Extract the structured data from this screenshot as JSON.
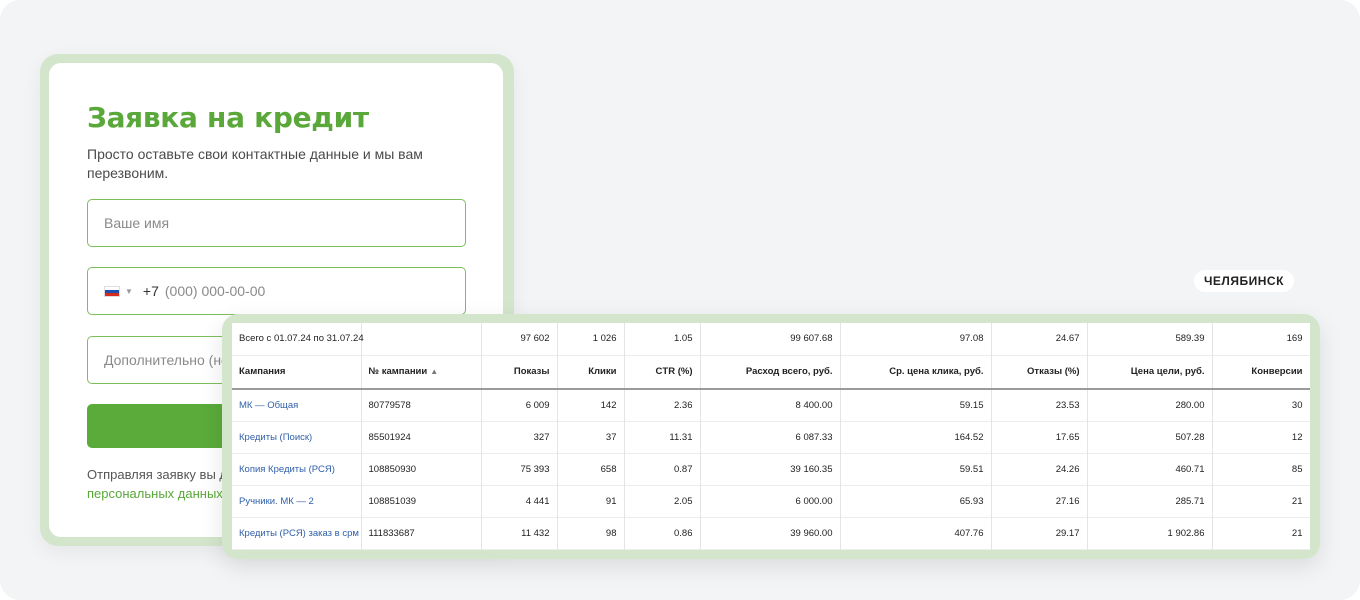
{
  "form": {
    "title": "Заявка на кредит",
    "description": "Просто оставьте свои контактные данные и мы вам перезвоним.",
    "name_placeholder": "Ваше имя",
    "phone_code": "+7",
    "phone_placeholder": "(000) 000-00-00",
    "extra_placeholder": "Дополнительно (не",
    "consent_text": "Отправляя заявку вы да",
    "consent_link": "персональных данных."
  },
  "city": "ЧЕЛЯБИНСК",
  "table": {
    "total": {
      "label": "Всего с 01.07.24 по 31.07.24",
      "id": "",
      "impressions": "97 602",
      "clicks": "1 026",
      "ctr": "1.05",
      "spend": "99 607.68",
      "cpc": "97.08",
      "bounce": "24.67",
      "goal_cost": "589.39",
      "conversions": "169"
    },
    "headers": {
      "campaign": "Кампания",
      "id": "№ кампании",
      "impressions": "Показы",
      "clicks": "Клики",
      "ctr": "CTR (%)",
      "spend": "Расход всего, руб.",
      "cpc": "Ср. цена клика, руб.",
      "bounce": "Отказы (%)",
      "goal_cost": "Цена цели, руб.",
      "conversions": "Конверсии"
    },
    "rows": [
      {
        "campaign": "МК — Общая",
        "id": "80779578",
        "impressions": "6 009",
        "clicks": "142",
        "ctr": "2.36",
        "spend": "8 400.00",
        "cpc": "59.15",
        "bounce": "23.53",
        "goal_cost": "280.00",
        "conversions": "30"
      },
      {
        "campaign": "Кредиты (Поиск)",
        "id": "85501924",
        "impressions": "327",
        "clicks": "37",
        "ctr": "11.31",
        "spend": "6 087.33",
        "cpc": "164.52",
        "bounce": "17.65",
        "goal_cost": "507.28",
        "conversions": "12"
      },
      {
        "campaign": "Копия Кредиты (РСЯ)",
        "id": "108850930",
        "impressions": "75 393",
        "clicks": "658",
        "ctr": "0.87",
        "spend": "39 160.35",
        "cpc": "59.51",
        "bounce": "24.26",
        "goal_cost": "460.71",
        "conversions": "85"
      },
      {
        "campaign": "Ручники. МК — 2",
        "id": "108851039",
        "impressions": "4 441",
        "clicks": "91",
        "ctr": "2.05",
        "spend": "6 000.00",
        "cpc": "65.93",
        "bounce": "27.16",
        "goal_cost": "285.71",
        "conversions": "21"
      },
      {
        "campaign": "Кредиты (РСЯ) заказ в срм",
        "id": "111833687",
        "impressions": "11 432",
        "clicks": "98",
        "ctr": "0.86",
        "spend": "39 960.00",
        "cpc": "407.76",
        "bounce": "29.17",
        "goal_cost": "1 902.86",
        "conversions": "21"
      }
    ]
  }
}
